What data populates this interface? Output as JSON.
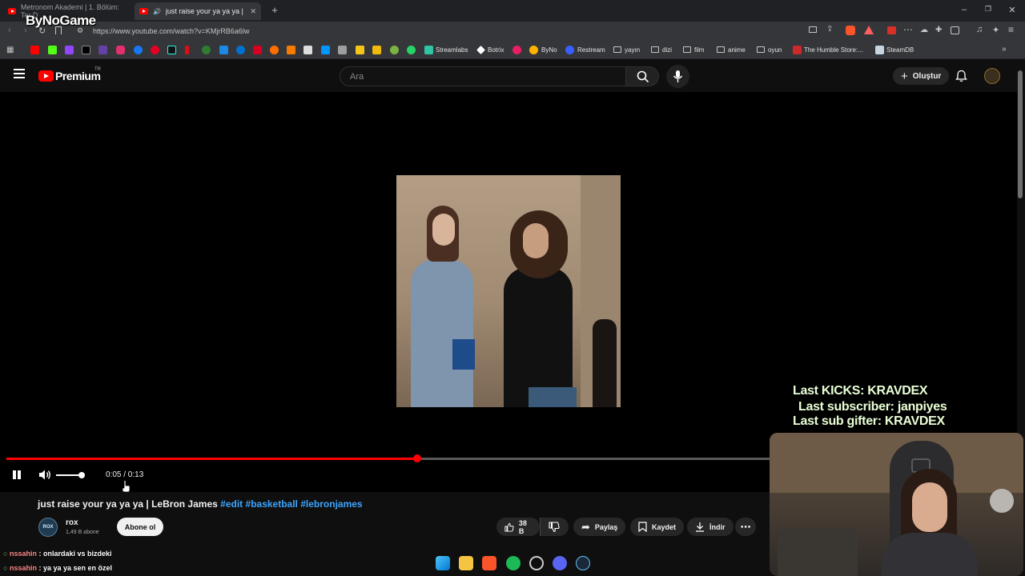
{
  "browser": {
    "tabs": [
      {
        "title": "Metronom Akademi | 1. Bölüm: Ter D"
      },
      {
        "title": "just raise your ya ya ya | LeBr"
      }
    ],
    "url": "https://www.youtube.com/watch?v=KMjrRB6a6lw",
    "bookmarks": [
      "Streamlabs",
      "Botrix",
      "ByNo",
      "Restream",
      "yayın",
      "dizi",
      "film",
      "anime",
      "oyun",
      "The Humble Store:...",
      "SteamDB"
    ]
  },
  "stream_logo": "ByNoGame",
  "youtube": {
    "brand": "Premium",
    "region": "TR",
    "search_placeholder": "Ara",
    "create_label": "Oluştur"
  },
  "player": {
    "time": "0:05 / 0:13",
    "progress_fraction": 0.538,
    "volume_fraction": 1.0
  },
  "overlay": {
    "last_kicks": "Last KICKS: KRAVDEX",
    "last_subscriber": "Last subscriber: janpiyes",
    "last_sub_gifter": "Last sub gifter: KRAVDEX"
  },
  "video": {
    "title_main": "just raise your ya ya ya | LeBron James",
    "hashtags": [
      "#edit",
      "#basketball",
      "#lebronjames"
    ],
    "channel_name": "rox",
    "channel_avatar_text": "ROX",
    "subscribers": "1,49 B abone",
    "subscribe_label": "Abone ol",
    "like_count": "38 B",
    "share_label": "Paylaş",
    "save_label": "Kaydet",
    "download_label": "İndir"
  },
  "chat": [
    {
      "user": "nssahin",
      "message": ": onlardaki vs bizdeki"
    },
    {
      "user": "nssahin",
      "message": ": ya ya ya sen en özel"
    }
  ],
  "colors": {
    "youtube_red": "#ff0000",
    "link_blue": "#3ea6ff",
    "overlay_text": "#e9ffd6"
  }
}
